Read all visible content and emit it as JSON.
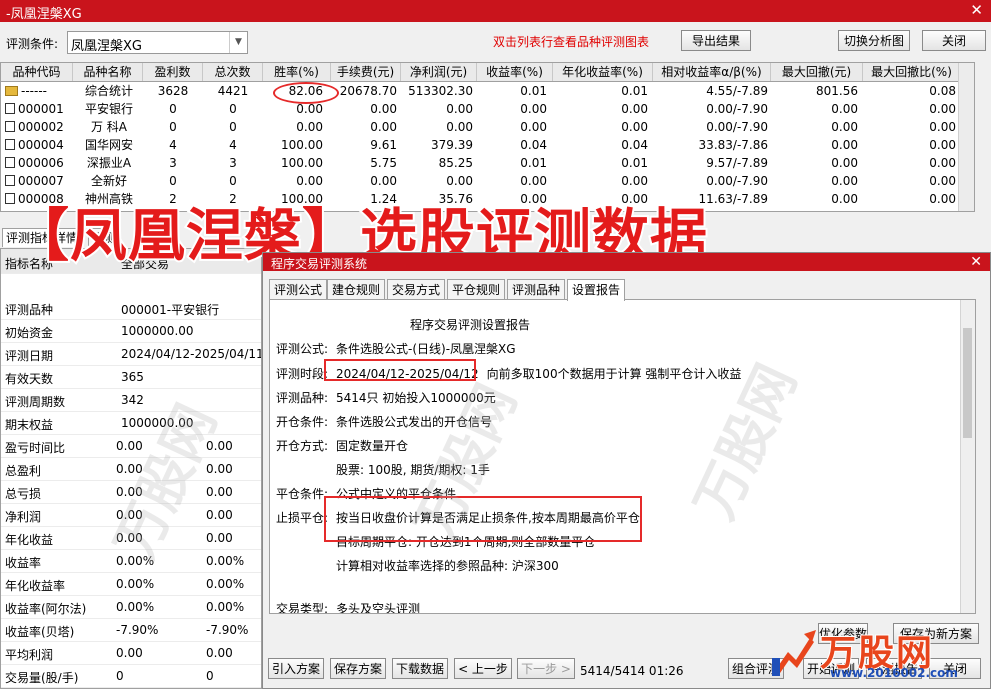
{
  "window": {
    "title": "-凤凰涅槃XG",
    "close": "✕"
  },
  "toolbar": {
    "label": "评测条件:",
    "combo_value": "凤凰涅槃XG",
    "hint": "双击列表行查看品种评测图表",
    "export_btn": "导出结果",
    "switch_btn": "切换分析图",
    "close_btn": "关闭"
  },
  "grid": {
    "headers": [
      "品种代码",
      "品种名称",
      "盈利数",
      "总次数",
      "胜率(%)",
      "手续费(元)",
      "净利润(元)",
      "收益率(%)",
      "年化收益率(%)",
      "相对收益率α/β(%)",
      "最大回撤(元)",
      "最大回撤比(%)"
    ],
    "rows": [
      {
        "code": "------",
        "name": "综合统计",
        "win": "3628",
        "total": "4421",
        "rate": "82.06",
        "fee": "20678.70",
        "net": "513302.30",
        "ret": "0.01",
        "annual": "0.01",
        "rel": "4.55/-7.89",
        "dd": "801.56",
        "ddr": "0.08"
      },
      {
        "code": "000001",
        "name": "平安银行",
        "win": "0",
        "total": "0",
        "rate": "0.00",
        "fee": "0.00",
        "net": "0.00",
        "ret": "0.00",
        "annual": "0.00",
        "rel": "0.00/-7.90",
        "dd": "0.00",
        "ddr": "0.00"
      },
      {
        "code": "000002",
        "name": "万 科A",
        "win": "0",
        "total": "0",
        "rate": "0.00",
        "fee": "0.00",
        "net": "0.00",
        "ret": "0.00",
        "annual": "0.00",
        "rel": "0.00/-7.90",
        "dd": "0.00",
        "ddr": "0.00"
      },
      {
        "code": "000004",
        "name": "国华网安",
        "win": "4",
        "total": "4",
        "rate": "100.00",
        "fee": "9.61",
        "net": "379.39",
        "ret": "0.04",
        "annual": "0.04",
        "rel": "33.83/-7.86",
        "dd": "0.00",
        "ddr": "0.00"
      },
      {
        "code": "000006",
        "name": "深振业A",
        "win": "3",
        "total": "3",
        "rate": "100.00",
        "fee": "5.75",
        "net": "85.25",
        "ret": "0.01",
        "annual": "0.01",
        "rel": "9.57/-7.89",
        "dd": "0.00",
        "ddr": "0.00"
      },
      {
        "code": "000007",
        "name": "全新好",
        "win": "0",
        "total": "0",
        "rate": "0.00",
        "fee": "0.00",
        "net": "0.00",
        "ret": "0.00",
        "annual": "0.00",
        "rel": "0.00/-7.90",
        "dd": "0.00",
        "ddr": "0.00"
      },
      {
        "code": "000008",
        "name": "神州高铁",
        "win": "2",
        "total": "2",
        "rate": "100.00",
        "fee": "1.24",
        "net": "35.76",
        "ret": "0.00",
        "annual": "0.00",
        "rel": "11.63/-7.89",
        "dd": "0.00",
        "ddr": "0.00"
      }
    ]
  },
  "banner": "【凤凰涅槃】选股评测数据",
  "left": {
    "tabs": [
      "评测指标详情",
      "评测"
    ],
    "header": {
      "k": "指标名称",
      "v": "全部交易"
    },
    "rows": [
      {
        "k": "评测品种",
        "v1": "000001-平安银行",
        "v2": ""
      },
      {
        "k": "初始资金",
        "v1": "1000000.00",
        "v2": ""
      },
      {
        "k": "评测日期",
        "v1": "2024/04/12-2025/04/11",
        "v2": ""
      },
      {
        "k": "有效天数",
        "v1": "365",
        "v2": ""
      },
      {
        "k": "评测周期数",
        "v1": "342",
        "v2": ""
      },
      {
        "k": "期末权益",
        "v1": "1000000.00",
        "v2": ""
      },
      {
        "k": "盈亏时间比",
        "v1": "0.00",
        "v2": "0.00"
      },
      {
        "k": "总盈利",
        "v1": "0.00",
        "v2": "0.00"
      },
      {
        "k": "总亏损",
        "v1": "0.00",
        "v2": "0.00"
      },
      {
        "k": "净利润",
        "v1": "0.00",
        "v2": "0.00"
      },
      {
        "k": "年化收益",
        "v1": "0.00",
        "v2": "0.00"
      },
      {
        "k": "收益率",
        "v1": "0.00%",
        "v2": "0.00%"
      },
      {
        "k": "年化收益率",
        "v1": "0.00%",
        "v2": "0.00%"
      },
      {
        "k": "收益率(阿尔法)",
        "v1": "0.00%",
        "v2": "0.00%"
      },
      {
        "k": "收益率(贝塔)",
        "v1": "-7.90%",
        "v2": "-7.90%"
      },
      {
        "k": "平均利润",
        "v1": "0.00",
        "v2": "0.00"
      },
      {
        "k": "交易量(股/手)",
        "v1": "0",
        "v2": "0"
      }
    ]
  },
  "dialog": {
    "title": "程序交易评测系统",
    "close": "✕",
    "tabs": [
      "评测公式",
      "建仓规则",
      "交易方式",
      "平仓规则",
      "评测品种",
      "设置报告"
    ],
    "report_title": "程序交易评测设置报告",
    "lines": [
      {
        "k": "评测公式:",
        "v": "条件选股公式-(日线)-凤凰涅槃XG"
      },
      {
        "k": "评测时段:",
        "v": "2024/04/12-2025/04/12",
        "extra": "向前多取100个数据用于计算 强制平仓计入收益"
      },
      {
        "k": "评测品种:",
        "v": "5414只 初始投入1000000元"
      },
      {
        "k": "开仓条件:",
        "v": "条件选股公式发出的开仓信号"
      },
      {
        "k": "开仓方式:",
        "v": "固定数量开仓"
      },
      {
        "k": "",
        "v": "股票: 100股, 期货/期权: 1手"
      },
      {
        "k": "平仓条件:",
        "v": "公式中定义的平仓条件"
      },
      {
        "k": "止损平仓:",
        "v": "按当日收盘价计算是否满足止损条件,按本周期最高价平仓"
      },
      {
        "k": "",
        "v": "目标周期平仓: 开仓达到1个周期,则全部数量平仓"
      },
      {
        "k": "",
        "v": "计算相对收益率选择的参照品种: 沪深300"
      },
      {
        "k": "交易类型:",
        "v": "多头及空头评测"
      }
    ],
    "opt_btn": "优化参数",
    "save_plan_btn": "保存为新方案",
    "buttons": [
      "引入方案",
      "保存方案",
      "下载数据",
      "< 上一步",
      "下一步 >"
    ],
    "status": "5414/5414 01:26",
    "right_buttons": [
      "组合评测",
      "开始评测",
      "评测报告",
      "关闭"
    ]
  },
  "watermark": {
    "text": "万股网",
    "url": "www.2016002.com"
  }
}
